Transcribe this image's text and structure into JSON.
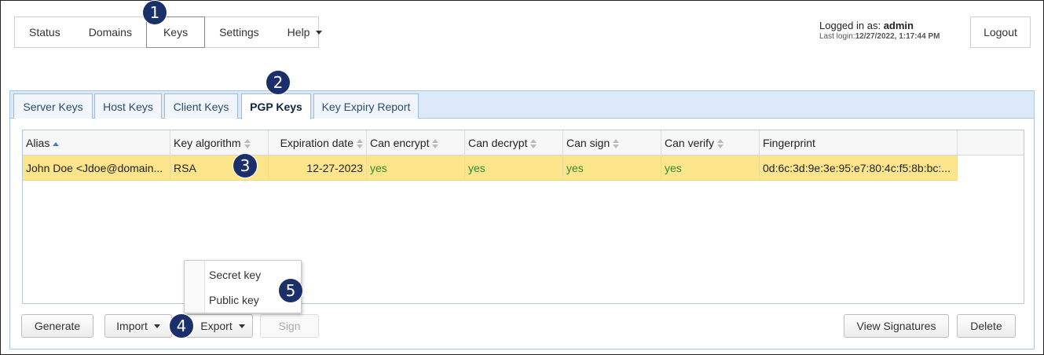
{
  "nav": {
    "items": [
      {
        "label": "Status"
      },
      {
        "label": "Domains"
      },
      {
        "label": "Keys"
      },
      {
        "label": "Settings"
      },
      {
        "label": "Help"
      }
    ],
    "active": "Keys"
  },
  "user": {
    "logged_in_prefix": "Logged in as: ",
    "username": "admin",
    "last_login_prefix": "Last login:",
    "last_login": "12/27/2022, 1:17:44 PM",
    "logout_label": "Logout"
  },
  "tabs": [
    {
      "label": "Server Keys"
    },
    {
      "label": "Host Keys"
    },
    {
      "label": "Client Keys"
    },
    {
      "label": "PGP Keys"
    },
    {
      "label": "Key Expiry Report"
    }
  ],
  "active_tab": "PGP Keys",
  "grid": {
    "columns": [
      {
        "label": "Alias",
        "sort": "asc"
      },
      {
        "label": "Key algorithm",
        "sort": "none"
      },
      {
        "label": "Expiration date",
        "sort": "none"
      },
      {
        "label": "Can encrypt",
        "sort": "none"
      },
      {
        "label": "Can decrypt",
        "sort": "none"
      },
      {
        "label": "Can sign",
        "sort": "none"
      },
      {
        "label": "Can verify",
        "sort": "none"
      },
      {
        "label": "Fingerprint",
        "sort": "none"
      }
    ],
    "rows": [
      {
        "alias": "John Doe <Jdoe@domain...",
        "algorithm": "RSA",
        "expiration": "12-27-2023",
        "can_encrypt": "yes",
        "can_decrypt": "yes",
        "can_sign": "yes",
        "can_verify": "yes",
        "fingerprint": "0d:6c:3d:9e:3e:95:e7:80:4c:f5:8b:bc:..."
      }
    ]
  },
  "buttons": {
    "generate": "Generate",
    "import": "Import",
    "export": "Export",
    "sign": "Sign",
    "view_signatures": "View Signatures",
    "delete": "Delete"
  },
  "export_menu": [
    "Secret key",
    "Public key"
  ],
  "callouts": [
    "1",
    "2",
    "3",
    "4",
    "5"
  ],
  "colors": {
    "selected_row": "#fde58c",
    "yes_text": "#2f8a2f",
    "tabbar": "#dbe9f8",
    "callout": "#1b2f6b"
  }
}
